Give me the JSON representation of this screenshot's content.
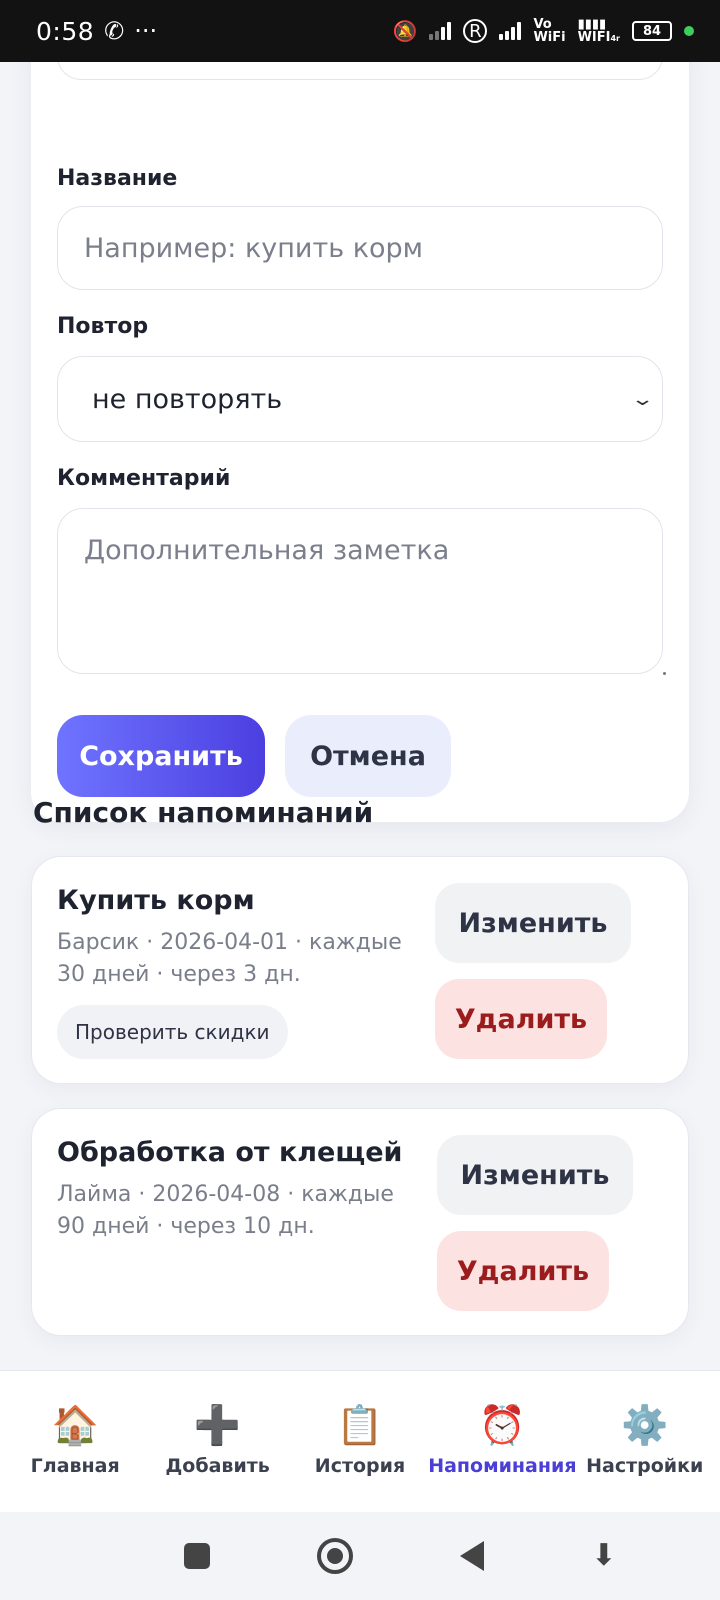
{
  "status_bar": {
    "time": "0:58",
    "battery": "84",
    "vowifi_top": "Vo",
    "vowifi_bottom": "WiFi",
    "wifi_label": "WIFI",
    "wifi_sub": "4r"
  },
  "form": {
    "name_label": "Название",
    "name_placeholder": "Например: купить корм",
    "repeat_label": "Повтор",
    "repeat_value": "не повторять",
    "comment_label": "Комментарий",
    "comment_placeholder": "Дополнительная заметка",
    "save_label": "Сохранить",
    "cancel_label": "Отмена"
  },
  "list": {
    "title": "Список напоминаний",
    "items": [
      {
        "title": "Купить корм",
        "meta_line1": "Барсик · 2026-04-01 · каждые",
        "meta_line2": "30 дней · через 3 дн.",
        "chip": "Проверить скидки",
        "edit_label": "Изменить",
        "delete_label": "Удалить"
      },
      {
        "title": "Обработка от клещей",
        "meta_line1": "Лайма · 2026-04-08 · каждые",
        "meta_line2": "90 дней · через 10 дн.",
        "edit_label": "Изменить",
        "delete_label": "Удалить"
      }
    ]
  },
  "bottom_nav": {
    "active": "Напоминания",
    "items": [
      {
        "label": "Главная",
        "icon": "🏠"
      },
      {
        "label": "Добавить",
        "icon": "➕"
      },
      {
        "label": "История",
        "icon": "📋"
      },
      {
        "label": "Напоминания",
        "icon": "⏰"
      },
      {
        "label": "Настройки",
        "icon": "⚙️"
      }
    ]
  },
  "colors": {
    "accent": "#4b3fd6",
    "save_gradient_start": "#6f74ff",
    "save_gradient_end": "#4b3fe0",
    "delete_bg": "#fde2e2",
    "delete_text": "#9b1c1c"
  }
}
